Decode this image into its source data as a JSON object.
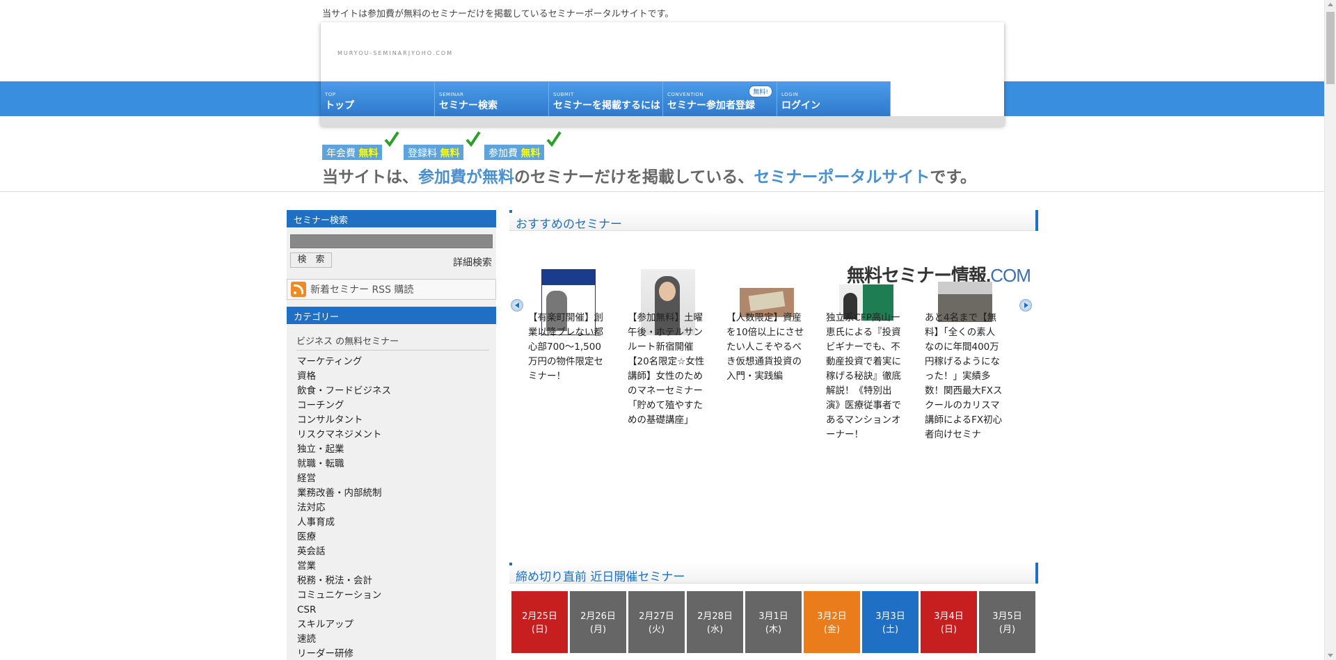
{
  "site": {
    "tagline": "当サイトは参加費が無料のセミナーだけを掲載しているセミナーポータルサイトです。",
    "logo_main": "無料セミナー情報.",
    "logo_com": "COM",
    "logo_sub": "MURYOU-SEMINARJYOHO.COM"
  },
  "nav": [
    {
      "en": "TOP",
      "label": "トップ"
    },
    {
      "en": "SEMINAR",
      "label": "セミナー検索"
    },
    {
      "en": "SUBMIT",
      "label": "セミナーを掲載するには"
    },
    {
      "en": "CONVENTION",
      "label": "セミナー参加者登録",
      "badge": "無料!"
    },
    {
      "en": "LOGIN",
      "label": "ログイン"
    }
  ],
  "banner": {
    "fees": [
      {
        "label": "年会費",
        "free": "無料"
      },
      {
        "label": "登録料",
        "free": "無料"
      },
      {
        "label": "参加費",
        "free": "無料"
      }
    ],
    "text_1": "当サイトは、",
    "text_2": "参加費が無料",
    "text_3": "のセミナーだけを掲載している、",
    "text_4": "セミナーポータルサイト",
    "text_5": "です。"
  },
  "sidebar": {
    "search_heading": "セミナー検索",
    "search_value": "",
    "search_button": "検　索",
    "advanced_search": "詳細検索",
    "rss_label": "新着セミナー RSS 購読",
    "category_heading": "カテゴリー",
    "category_title": "ビジネス の無料セミナー",
    "categories": [
      "マーケティング",
      "資格",
      "飲食・フードビジネス",
      "コーチング",
      "コンサルタント",
      "リスクマネジメント",
      "独立・起業",
      "就職・転職",
      "経営",
      "業務改善・内部統制",
      "法対応",
      "人事育成",
      "医療",
      "英会話",
      "営業",
      "税務・税法・会計",
      "コミュニケーション",
      "CSR",
      "スキルアップ",
      "速読",
      "リーダー研修"
    ]
  },
  "recommended": {
    "heading": "おすすめのセミナー",
    "items": [
      {
        "title": "【有楽町開催】創業以降ブレない都心部700〜1,500万円の物件限定セミナー！"
      },
      {
        "title": "【参加無料】土曜午後・ホテルサンルート新宿開催【20名限定☆女性講師】女性のためのマネーセミナー「貯めて殖やすための基礎講座」"
      },
      {
        "title": "【人数限定】資産を10倍以上にさせたい人こそやるべき仮想通貨投資の入門・実践編"
      },
      {
        "title": "独立系CFP高山一恵氏による『投資ビギナーでも、不動産投資で着実に稼げる秘訣』徹底解説！《特別出演》医療従事者であるマンションオーナー！"
      },
      {
        "title": "あと4名まで【無料】「全くの素人なのに年間400万円稼げるようになった！」実績多数！関西最大FXスクールのカリスマ講師によるFX初心者向けセミナ"
      }
    ]
  },
  "deadline": {
    "heading": "締め切り直前 近日開催セミナー",
    "dates": [
      {
        "date": "2月25日",
        "day": "(日)",
        "color": "red"
      },
      {
        "date": "2月26日",
        "day": "(月)",
        "color": "gray"
      },
      {
        "date": "2月27日",
        "day": "(火)",
        "color": "gray"
      },
      {
        "date": "2月28日",
        "day": "(水)",
        "color": "gray"
      },
      {
        "date": "3月1日",
        "day": "(木)",
        "color": "gray"
      },
      {
        "date": "3月2日",
        "day": "(金)",
        "color": "orange"
      },
      {
        "date": "3月3日",
        "day": "(土)",
        "color": "blue"
      },
      {
        "date": "3月4日",
        "day": "(日)",
        "color": "red"
      },
      {
        "date": "3月5日",
        "day": "(月)",
        "color": "gray"
      }
    ]
  },
  "colors": {
    "nav_blue": "#3a8ee0",
    "heading_blue": "#1f6fc5",
    "sunday_red": "#c71f1f",
    "friday_orange": "#ea7c1c",
    "saturday_blue": "#1f6fc5"
  }
}
